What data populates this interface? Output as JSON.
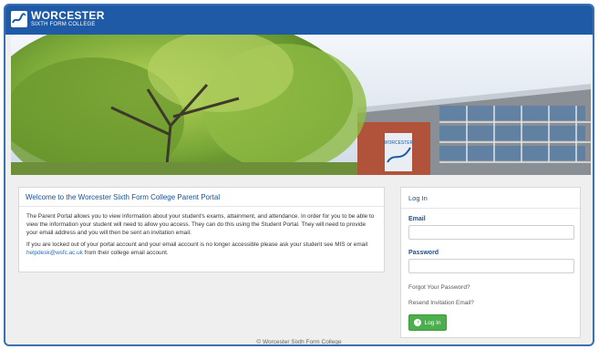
{
  "brand": {
    "title": "WORCESTER",
    "subtitle": "SIXTH FORM COLLEGE",
    "logo_icon": "college-logo-icon",
    "color": "#1f5aa6"
  },
  "hero": {
    "building_sign": "WORCESTER"
  },
  "welcome": {
    "title": "Welcome to the Worcester Sixth Form College Parent Portal",
    "paragraph1": "The Parent Portal allows you to view information about your student's exams, attainment, and attendance. In order for you to be able to view the information your student will need to allow you access. They can do this using the Student Portal. They will need to provide your email address and you will then be sent an invitation email.",
    "paragraph2_before": "If you are locked out of your portal account and your email account is no longer accessible please ask your student see MIS or email ",
    "paragraph2_link": "helpdesk@wsfc.ac.uk",
    "paragraph2_after": " from their college email account."
  },
  "login": {
    "title": "Log In",
    "email_label": "Email",
    "email_value": "",
    "password_label": "Password",
    "password_value": "",
    "forgot_link": "Forgot Your Password?",
    "resend_link": "Resend Invitation Email?",
    "button_label": "Log In",
    "button_icon": "login-arrow-icon",
    "button_color": "#4cae4c"
  },
  "footer": {
    "text": "© Worcester Sixth Form College"
  }
}
